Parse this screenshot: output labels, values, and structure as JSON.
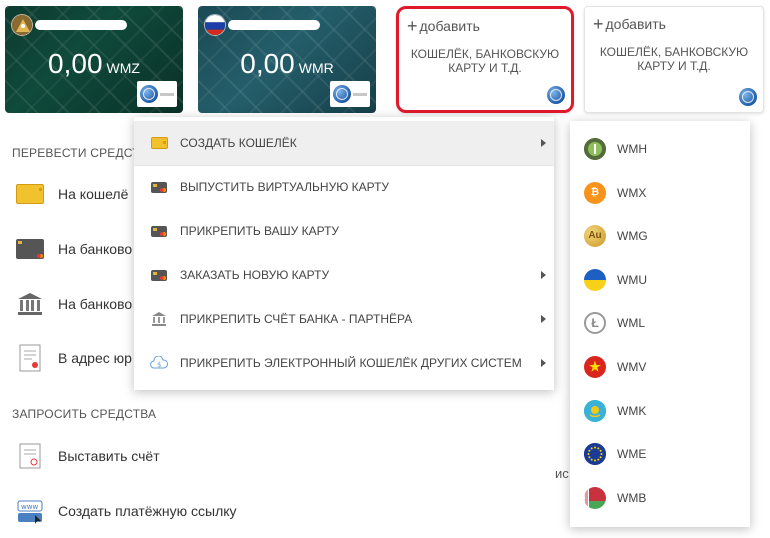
{
  "wallets": [
    {
      "amount": "0,00",
      "currency": "WMZ",
      "flag": "wm-pyramid"
    },
    {
      "amount": "0,00",
      "currency": "WMR",
      "flag": "russia"
    }
  ],
  "add_cards": [
    {
      "label": "добавить",
      "description": "КОШЕЛЁК, БАНКОВСКУЮ КАРТУ И Т.Д."
    },
    {
      "label": "добавить",
      "description": "КОШЕЛЁК, БАНКОВСКУЮ КАРТУ И Т.Д."
    }
  ],
  "transfer": {
    "title": "ПЕРЕВЕСТИ СРЕДСТ",
    "items": [
      {
        "label": "На кошелё",
        "icon": "wallet-icon"
      },
      {
        "label": "На банково",
        "icon": "bank-card-icon"
      },
      {
        "label": "На банково",
        "icon": "bank-building-icon"
      },
      {
        "label": "В адрес юр",
        "icon": "document-icon"
      }
    ]
  },
  "request": {
    "title": "ЗАПРОСИТЬ СРЕДСТВА",
    "items": [
      {
        "label": "Выставить счёт",
        "icon": "invoice-icon"
      },
      {
        "label": "Создать платёжную ссылку",
        "icon": "payment-link-icon"
      }
    ]
  },
  "right_cut_text": "ис",
  "menu": {
    "items": [
      {
        "label": "СОЗДАТЬ КОШЕЛЁК",
        "icon": "wallet-icon",
        "has_submenu": true,
        "active": true
      },
      {
        "label": "ВЫПУСТИТЬ ВИРТУАЛЬНУЮ КАРТУ",
        "icon": "bank-card-icon",
        "has_submenu": false
      },
      {
        "label": "ПРИКРЕПИТЬ ВАШУ КАРТУ",
        "icon": "bank-card-icon",
        "has_submenu": false
      },
      {
        "label": "ЗАКАЗАТЬ НОВУЮ КАРТУ",
        "icon": "bank-card-icon",
        "has_submenu": true
      },
      {
        "label": "ПРИКРЕПИТЬ СЧЁТ БАНКА - ПАРТНЁРА",
        "icon": "bank-building-icon",
        "has_submenu": true
      },
      {
        "label": "ПРИКРЕПИТЬ ЭЛЕКТРОННЫЙ КОШЕЛЁК ДРУГИХ СИСТЕМ",
        "icon": "cloud-money-icon",
        "has_submenu": true
      }
    ]
  },
  "submenu": {
    "items": [
      {
        "label": "WMH",
        "icon": "wmh-coin-icon"
      },
      {
        "label": "WMX",
        "icon": "bitcoin-icon"
      },
      {
        "label": "WMG",
        "icon": "gold-icon",
        "glyph": "Au"
      },
      {
        "label": "WMU",
        "icon": "ukraine-flag-icon"
      },
      {
        "label": "WML",
        "icon": "litecoin-icon"
      },
      {
        "label": "WMV",
        "icon": "vietnam-flag-icon"
      },
      {
        "label": "WMK",
        "icon": "kazakhstan-flag-icon"
      },
      {
        "label": "WME",
        "icon": "eu-flag-icon"
      },
      {
        "label": "WMB",
        "icon": "belarus-flag-icon"
      }
    ]
  },
  "colors": {
    "highlight": "#e0192b",
    "menu_active_bg": "#efefef"
  }
}
